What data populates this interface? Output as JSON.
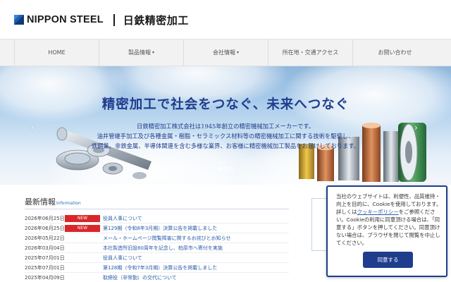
{
  "header": {
    "brand": "NIPPON STEEL",
    "company": "日鉄精密加工"
  },
  "nav": {
    "items": [
      {
        "label": "HOME",
        "has_dropdown": false
      },
      {
        "label": "製品情報",
        "has_dropdown": true
      },
      {
        "label": "会社情報",
        "has_dropdown": true
      },
      {
        "label": "所在地・交通アクセス",
        "has_dropdown": false
      },
      {
        "label": "お問い合わせ",
        "has_dropdown": false
      }
    ],
    "caret": "▾"
  },
  "hero": {
    "title": "精密加工で社会をつなぐ、未来へつなぐ",
    "line1": "日鉄精密加工株式会社は1945年創立の精密機械加工メーカーです。",
    "line2": "油井管継手加工及び各種金属・樹脂・セラミックス材料等の精密機械加工に関する技術を駆使し、",
    "line3": "鉄鋼業、非鉄金属、半導体関連を含む多様な業界、お客様に精密機械加工製品をお届けしております。",
    "prev_arrow": "‹",
    "next_arrow": "›",
    "slides_total": 3,
    "slide_active": 1
  },
  "news": {
    "title": "最新情報",
    "title_en": "Information",
    "items": [
      {
        "date": "2026年06月25日",
        "badge": "NEW",
        "text": "役員人事について"
      },
      {
        "date": "2026年06月25日",
        "badge": "NEW",
        "text": "第129期（令和8年3月期）決算公告を掲載しました"
      },
      {
        "date": "2026年05月22日",
        "badge": "",
        "text": "メール・ホームページ閲覧障害に関するお詫びとお知らせ"
      },
      {
        "date": "2026年03月04日",
        "badge": "",
        "text": "本社製造所旧設80周年を記念し、柏原市へ寄付を実施"
      },
      {
        "date": "2025年07月01日",
        "badge": "",
        "text": "役員人事について"
      },
      {
        "date": "2025年07月01日",
        "badge": "",
        "text": "第128期（令和7年3月期）決算公告を掲載しました"
      },
      {
        "date": "2025年04月09日",
        "badge": "",
        "text": "取締役（非常勤）の交代について"
      }
    ]
  },
  "cookie": {
    "text_before": "当社のウェブサイトは、利便性、品質維持・向上を目的に、Cookieを使用しております。詳しくは",
    "policy_link": "クッキーポリシー",
    "text_after": "をご参照ください。Cookieの利用に同意頂ける場合は、「同意する」ボタンを押してください。同意頂けない場合は、ブラウザを閉じて閲覧を中止してください。",
    "agree_label": "同意する"
  },
  "colors": {
    "brand_blue": "#1f3d8c",
    "link_blue": "#2a5ca8",
    "badge_red": "#d9262a"
  }
}
